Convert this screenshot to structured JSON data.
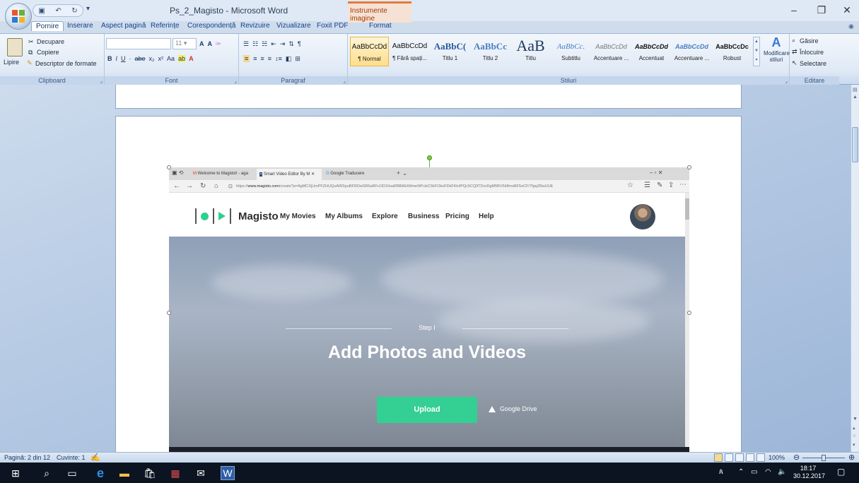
{
  "window": {
    "title": "Ps_2_Magisto - Microsoft Word",
    "context_tab_group": "Instrumente imagine"
  },
  "tabs": [
    "Pornire",
    "Inserare",
    "Aspect pagină",
    "Referințe",
    "Corespondență",
    "Revizuire",
    "Vizualizare",
    "Foxit PDF",
    "Format"
  ],
  "ribbon": {
    "clipboard": {
      "paste": "Lipire",
      "cut": "Decupare",
      "copy": "Copiere",
      "format_painter": "Descriptor de formate",
      "label": "Clipboard"
    },
    "font": {
      "size": "11",
      "label": "Font"
    },
    "paragraph": {
      "label": "Paragraf"
    },
    "styles": {
      "label": "Stiluri",
      "items": [
        {
          "preview": "AaBbCcDd",
          "name": "¶ Normal"
        },
        {
          "preview": "AaBbCcDd",
          "name": "¶ Fără spați..."
        },
        {
          "preview": "AaBbC(",
          "name": "Titlu 1"
        },
        {
          "preview": "AaBbCc",
          "name": "Titlu 2"
        },
        {
          "preview": "AaB",
          "name": "Titlu"
        },
        {
          "preview": "AaBbCc.",
          "name": "Subtitlu"
        },
        {
          "preview": "AaBbCcDd",
          "name": "Accentuare ..."
        },
        {
          "preview": "AaBbCcDd",
          "name": "Accentuat"
        },
        {
          "preview": "AaBbCcDd",
          "name": "Accentuare ..."
        },
        {
          "preview": "AaBbCcDc",
          "name": "Robust"
        }
      ],
      "change_styles": "Modificare stiluri"
    },
    "editing": {
      "find": "Găsire",
      "replace": "Înlocuire",
      "select": "Selectare",
      "label": "Editare"
    }
  },
  "browser": {
    "tabs": [
      "Welcome to Magisto! - aga",
      "Smart Video Editor By M",
      "Google Traducere"
    ],
    "url_prefix": "https://",
    "url_domain": "www.magisto.com",
    "url_rest": "/create?p=AgMCXjUmPFZHUQoAWSpuBFRDwSR6aRFcOD10oaRBBAEtWmeWFcbCSkFOkoFDkFKk4PQc5CQ9TDorDgM5BV5kBmd6F5eCF/7fgqZBwUUE"
  },
  "site": {
    "brand": "Magisto",
    "nav": [
      "My Movies",
      "My Albums",
      "Explore",
      "Business",
      "Pricing",
      "Help"
    ],
    "step": "Step I",
    "headline": "Add Photos and Videos",
    "upload": "Upload",
    "gdrive": "Google Drive"
  },
  "statusbar": {
    "page": "Pagină: 2 din 12",
    "words": "Cuvinte: 1",
    "zoom": "100%"
  },
  "taskbar": {
    "time": "18:17",
    "date": "30.12.2017"
  }
}
